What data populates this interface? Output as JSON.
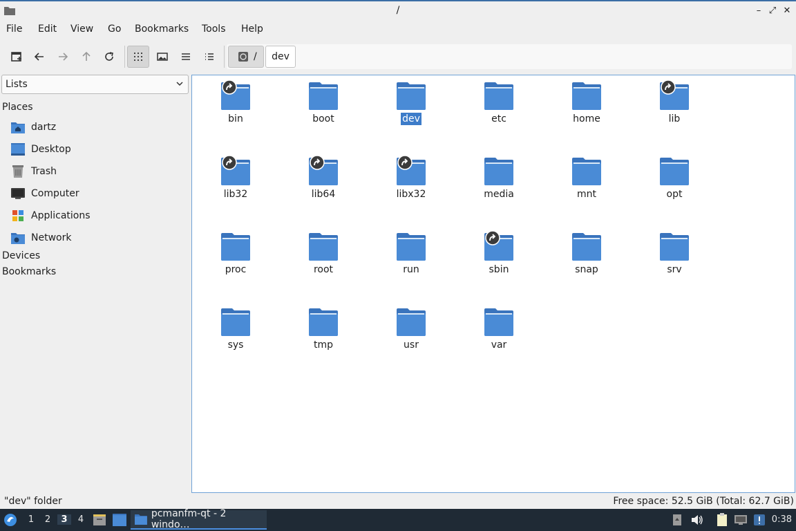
{
  "window": {
    "title": "/",
    "controls": {
      "minimize": "–",
      "maximize": "⤢",
      "close": "✕"
    }
  },
  "menu": [
    "File",
    "Edit",
    "View",
    "Go",
    "Bookmarks",
    "Tools",
    "Help"
  ],
  "toolbar": {
    "icons": [
      "new-tab-icon",
      "back-icon",
      "forward-icon",
      "up-icon",
      "reload-icon",
      "icon-view-icon",
      "thumbnail-view-icon",
      "compact-view-icon",
      "detailed-list-icon"
    ],
    "path": {
      "root": "/",
      "current": "dev"
    }
  },
  "sidebar": {
    "mode": "Lists",
    "places_header": "Places",
    "places": [
      {
        "label": "dartz",
        "icon": "home-folder-icon"
      },
      {
        "label": "Desktop",
        "icon": "desktop-icon"
      },
      {
        "label": "Trash",
        "icon": "trash-icon"
      },
      {
        "label": "Computer",
        "icon": "computer-icon"
      },
      {
        "label": "Applications",
        "icon": "applications-icon"
      },
      {
        "label": "Network",
        "icon": "network-icon"
      }
    ],
    "devices_header": "Devices",
    "bookmarks_header": "Bookmarks"
  },
  "files": [
    {
      "name": "bin",
      "link": true
    },
    {
      "name": "boot",
      "link": false
    },
    {
      "name": "dev",
      "link": false,
      "selected": true
    },
    {
      "name": "etc",
      "link": false
    },
    {
      "name": "home",
      "link": false
    },
    {
      "name": "lib",
      "link": true
    },
    {
      "name": "lib32",
      "link": true
    },
    {
      "name": "lib64",
      "link": true
    },
    {
      "name": "libx32",
      "link": true
    },
    {
      "name": "media",
      "link": false
    },
    {
      "name": "mnt",
      "link": false
    },
    {
      "name": "opt",
      "link": false
    },
    {
      "name": "proc",
      "link": false
    },
    {
      "name": "root",
      "link": false
    },
    {
      "name": "run",
      "link": false
    },
    {
      "name": "sbin",
      "link": true
    },
    {
      "name": "snap",
      "link": false
    },
    {
      "name": "srv",
      "link": false
    },
    {
      "name": "sys",
      "link": false
    },
    {
      "name": "tmp",
      "link": false
    },
    {
      "name": "usr",
      "link": false
    },
    {
      "name": "var",
      "link": false
    }
  ],
  "status": {
    "left": "\"dev\" folder",
    "right": "Free space: 52.5 GiB (Total: 62.7 GiB)"
  },
  "taskbar": {
    "desktops": [
      "1",
      "2",
      "3",
      "4"
    ],
    "current_desktop": "3",
    "task_label": "pcmanfm-qt - 2 windo…",
    "clock": "0:38"
  },
  "colors": {
    "folder": "#4a8bd6",
    "folder_tab": "#3a74bd",
    "selection": "#3d7cc9",
    "taskbar": "#1f2a35"
  }
}
